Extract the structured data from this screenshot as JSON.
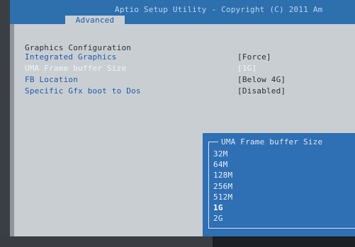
{
  "header": {
    "title": "Aptio Setup Utility - Copyright (C) 2011 Am",
    "active_tab": "Advanced"
  },
  "main": {
    "section_heading": "Graphics Configuration",
    "items": [
      {
        "label": "Integrated Graphics",
        "value": "[Force]"
      },
      {
        "label": "UMA Frame buffer Size",
        "value": "[1G]"
      },
      {
        "label": "FB Location",
        "value": "[Below 4G]"
      },
      {
        "label": "Specific Gfx boot to Dos",
        "value": "[Disabled]"
      }
    ]
  },
  "popup": {
    "title": "UMA Frame buffer Size",
    "options": [
      "32M",
      "64M",
      "128M",
      "256M",
      "512M",
      "1G",
      "2G"
    ],
    "selected": "1G"
  },
  "colors": {
    "title_bar": "#2e6fae",
    "content_bg": "#c9ced3",
    "item_blue": "#1f5ba8",
    "popup_bg": "#2f6fb3"
  }
}
